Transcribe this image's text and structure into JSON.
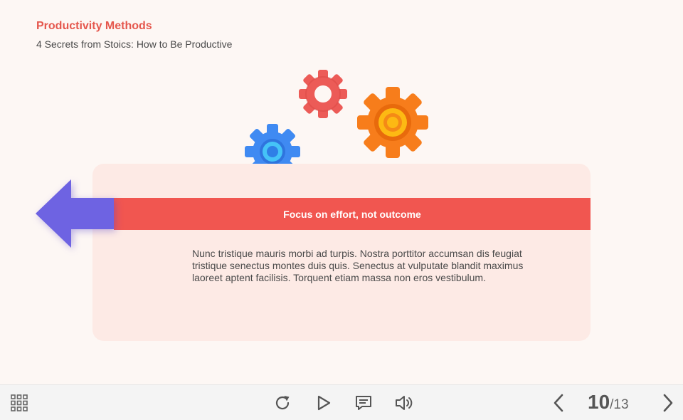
{
  "header": {
    "title": "Productivity Methods",
    "subtitle": "4 Secrets from Stoics: How to Be Productive"
  },
  "slide": {
    "banner_text": "Focus on effort, not outcome",
    "body": "Nunc tristique mauris morbi ad turpis. Nostra porttitor accumsan dis feugiat tristique senectus montes duis quis. Senectus at vulputate blandit maximus laoreet aptent facilisis. Torquent etiam massa non eros vestibulum.",
    "gears": [
      {
        "name": "red-gear-icon",
        "color": "#ec5b57"
      },
      {
        "name": "orange-gear-icon",
        "color": "#f77d1b"
      },
      {
        "name": "blue-gear-icon",
        "color": "#3f8af2"
      }
    ],
    "arrow": {
      "name": "left-arrow-icon",
      "color": "#6e63e2"
    }
  },
  "toolbar": {
    "menu_icon": "grid-menu-icon",
    "replay_icon": "replay-icon",
    "play_icon": "play-icon",
    "captions_icon": "captions-icon",
    "volume_icon": "volume-icon",
    "prev_icon": "chevron-left-icon",
    "next_icon": "chevron-right-icon",
    "current_page": "10",
    "total_pages": "/13"
  },
  "colors": {
    "accent": "#e5574d",
    "banner": "#f15650",
    "card_background": "#fdeae5",
    "page_background": "#fdf7f4",
    "toolbar_background": "#f4f4f4",
    "icon": "#555555"
  }
}
